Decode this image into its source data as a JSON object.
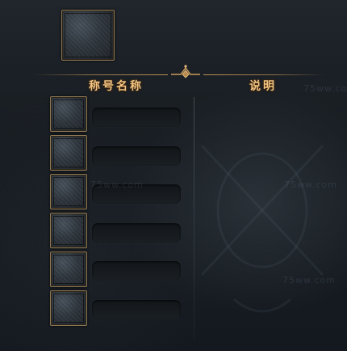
{
  "header": {
    "title_name": "称号名称",
    "title_desc": "说明"
  },
  "title_rows": [
    {
      "name": ""
    },
    {
      "name": ""
    },
    {
      "name": ""
    },
    {
      "name": ""
    },
    {
      "name": ""
    },
    {
      "name": ""
    }
  ],
  "watermarks": [
    "75ww.com",
    "75ww.com",
    "75ww.com",
    "75ww.com"
  ],
  "colors": {
    "header_gold": "#f2c684",
    "slot_border": "#8d7754",
    "background": "#181d22"
  }
}
